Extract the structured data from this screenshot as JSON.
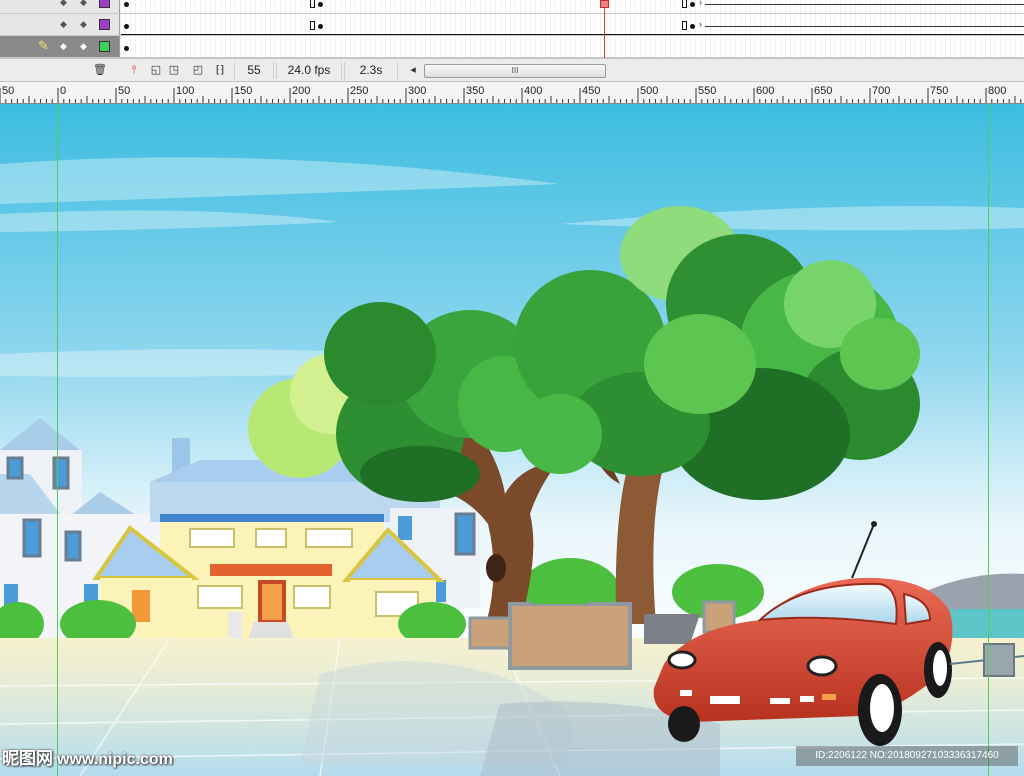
{
  "timeline": {
    "toolbar": {
      "current_frame": "55",
      "frame_rate": "24.0 fps",
      "elapsed_time": "2.3s",
      "scrollbar_grip": "III"
    },
    "layers": [
      {
        "swatch_color": "#9b3fc7"
      },
      {
        "swatch_color": "#3cd15a",
        "selected": true
      }
    ],
    "playhead_color": "#d84040"
  },
  "ruler": {
    "labels": [
      "50",
      "0",
      "50",
      "100",
      "150",
      "200",
      "250",
      "300",
      "350",
      "400",
      "450",
      "500",
      "550",
      "600",
      "650",
      "700",
      "750",
      "800"
    ]
  },
  "watermark": {
    "brand": "昵图网",
    "site": "www.nipic.com",
    "image_id": "ID:2206122 NO:20180927103336317460"
  },
  "colors": {
    "sky_top": "#3cbde0",
    "tree_green": "#3aa53c",
    "car_red": "#d6412d",
    "guide_green": "#4ecf4e"
  }
}
